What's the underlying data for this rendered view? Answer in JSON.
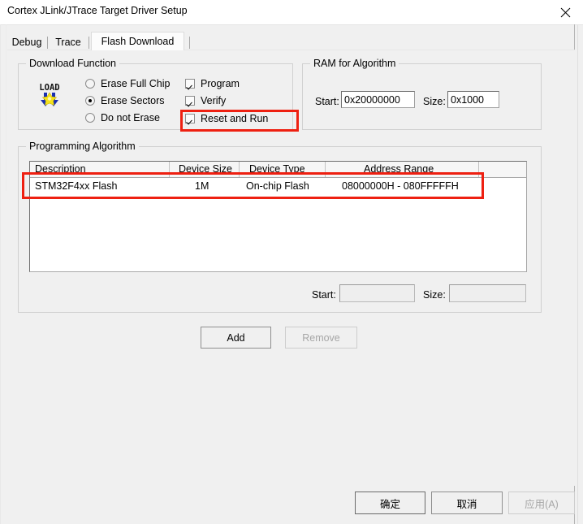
{
  "window": {
    "title": "Cortex JLink/JTrace Target Driver Setup",
    "close_icon": "close-icon"
  },
  "tabs": [
    {
      "label": "Debug",
      "active": false
    },
    {
      "label": "Trace",
      "active": false
    },
    {
      "label": "Flash Download",
      "active": true
    }
  ],
  "download_function": {
    "title": "Download Function",
    "icon": "load-icon",
    "icon_text": "LOAD",
    "radios": [
      {
        "label": "Erase Full Chip",
        "selected": false
      },
      {
        "label": "Erase Sectors",
        "selected": true
      },
      {
        "label": "Do not Erase",
        "selected": false
      }
    ],
    "checkboxes": [
      {
        "label": "Program",
        "checked": true
      },
      {
        "label": "Verify",
        "checked": true
      },
      {
        "label": "Reset and Run",
        "checked": true
      }
    ]
  },
  "ram_for_algorithm": {
    "title": "RAM for Algorithm",
    "start_label": "Start:",
    "start_value": "0x20000000",
    "size_label": "Size:",
    "size_value": "0x1000"
  },
  "programming_algorithm": {
    "title": "Programming Algorithm",
    "columns": [
      "Description",
      "Device Size",
      "Device Type",
      "Address Range"
    ],
    "rows": [
      {
        "description": "STM32F4xx Flash",
        "device_size": "1M",
        "device_type": "On-chip Flash",
        "address_range": "08000000H - 080FFFFFH"
      }
    ],
    "start_label": "Start:",
    "start_value": "",
    "start_placeholder": "",
    "size_label": "Size:",
    "size_value": "",
    "size_placeholder": "",
    "add_label": "Add",
    "remove_label": "Remove"
  },
  "dialog_buttons": {
    "ok": "确定",
    "cancel": "取消",
    "apply": "应用(A)"
  },
  "annotations": {
    "accent_color": "#ee2011",
    "highlight_1": "Reset and Run",
    "highlight_2": "STM32F4xx Flash"
  }
}
